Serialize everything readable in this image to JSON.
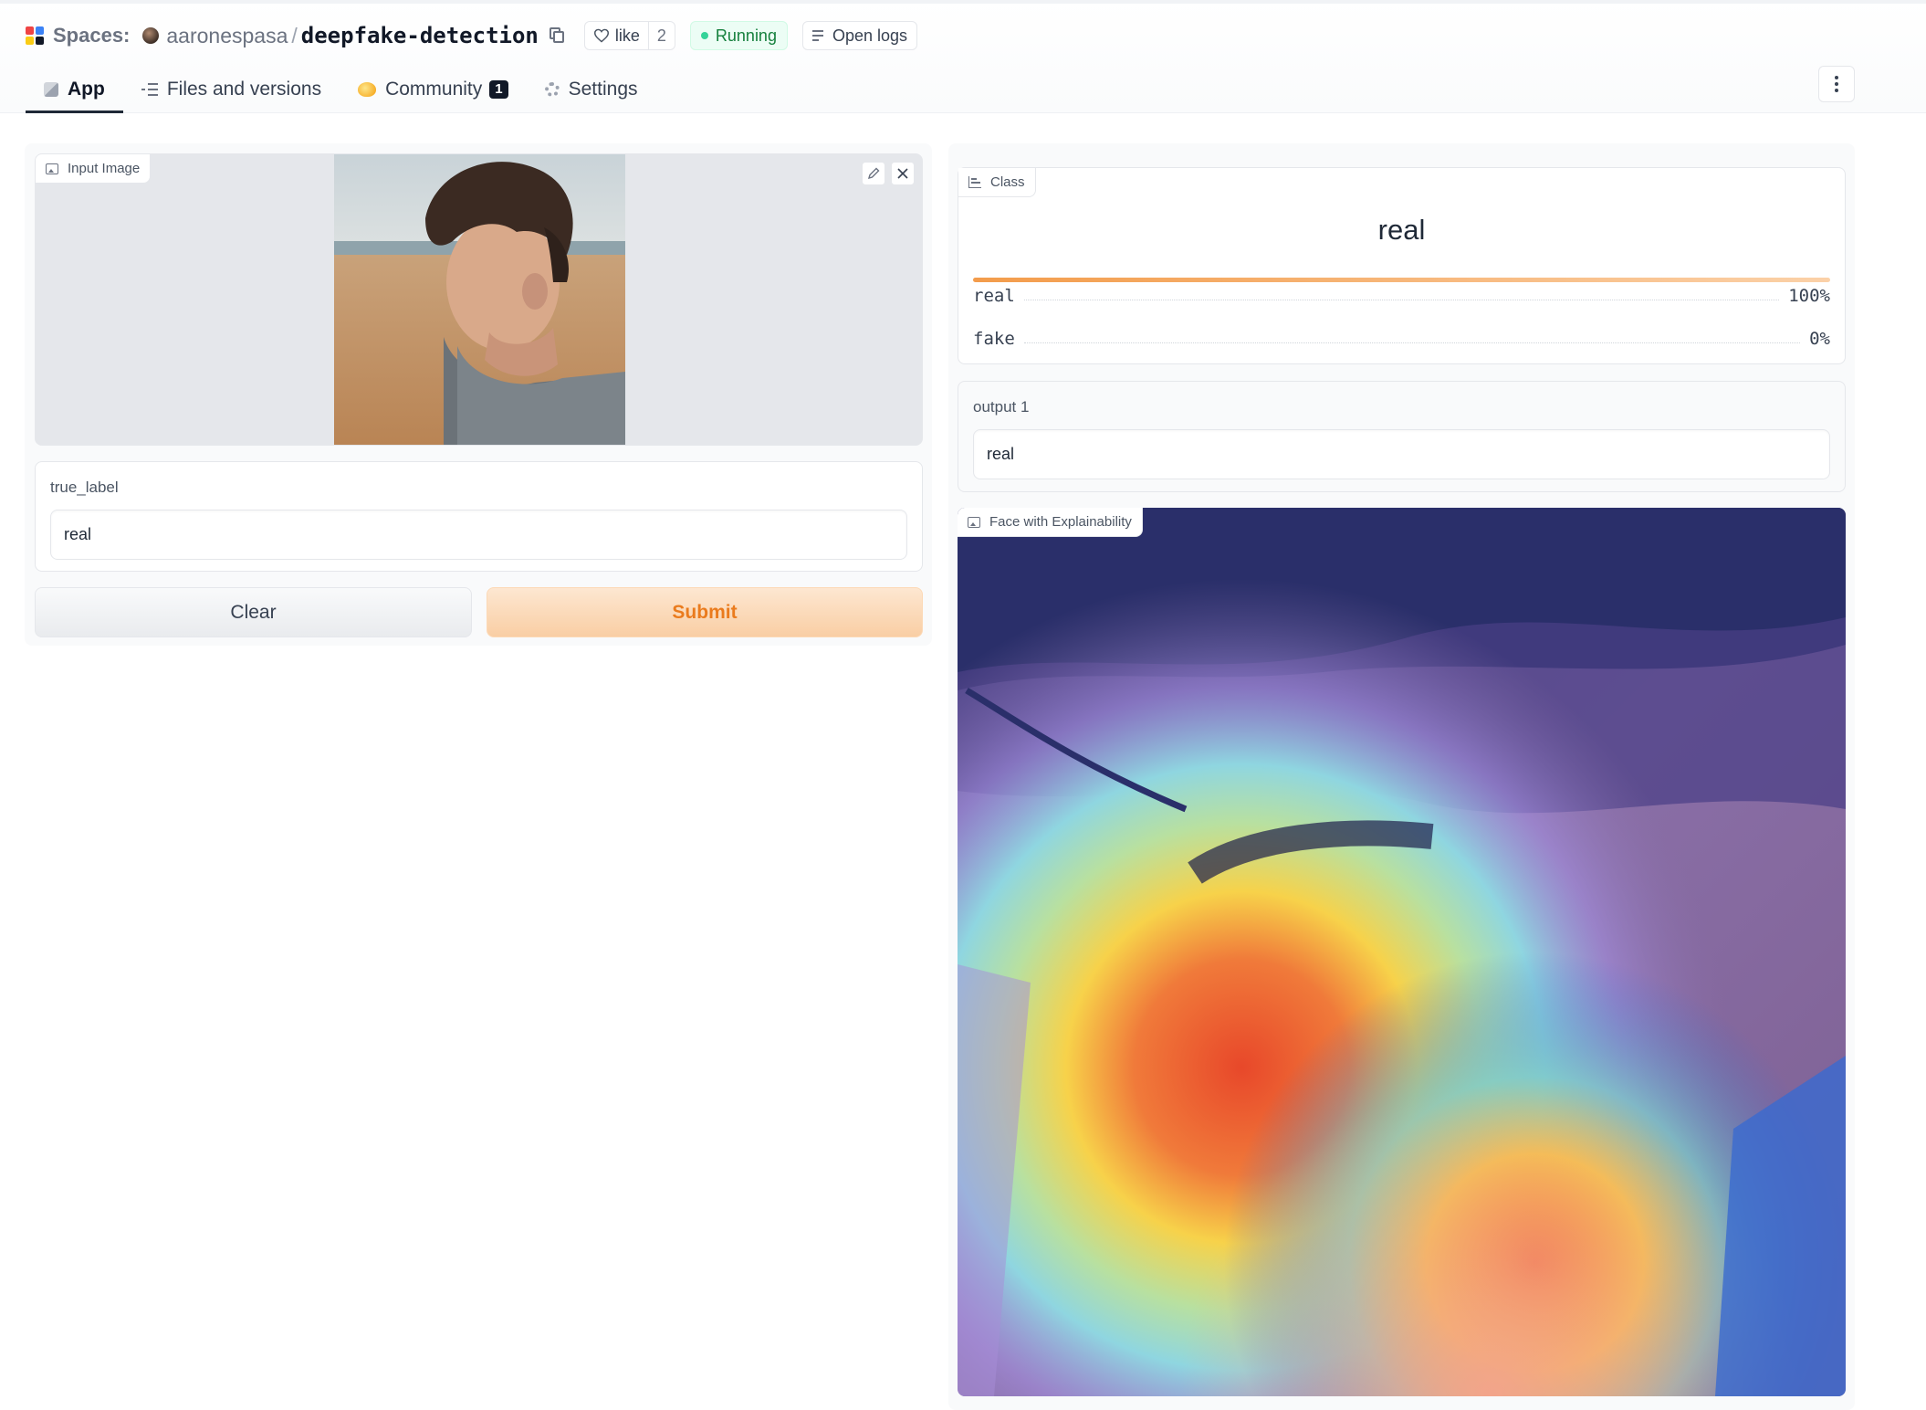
{
  "header": {
    "spaces_label": "Spaces:",
    "owner": "aaronespasa",
    "separator": "/",
    "repo": "deepfake-detection",
    "like_label": "like",
    "like_count": "2",
    "status": "Running",
    "logs_label": "Open logs"
  },
  "tabs": [
    {
      "label": "App",
      "icon": "cube-icon",
      "active": true
    },
    {
      "label": "Files and versions",
      "icon": "files-icon"
    },
    {
      "label": "Community",
      "icon": "community-icon",
      "badge": "1"
    },
    {
      "label": "Settings",
      "icon": "gear-icon"
    }
  ],
  "input_image": {
    "label": "Input Image"
  },
  "true_label": {
    "label": "true_label",
    "value": "real"
  },
  "buttons": {
    "clear": "Clear",
    "submit": "Submit"
  },
  "class_output": {
    "label": "Class",
    "prediction": "real",
    "confidences": [
      {
        "label": "real",
        "value": "100%",
        "fraction": 1.0
      },
      {
        "label": "fake",
        "value": "0%",
        "fraction": 0.0
      }
    ]
  },
  "output1": {
    "label": "output 1",
    "value": "real"
  },
  "face_output": {
    "label": "Face with Explainability"
  },
  "colors": {
    "accent": "#f39c4b",
    "submit_text": "#ea7b1d",
    "running": "#15803d"
  }
}
